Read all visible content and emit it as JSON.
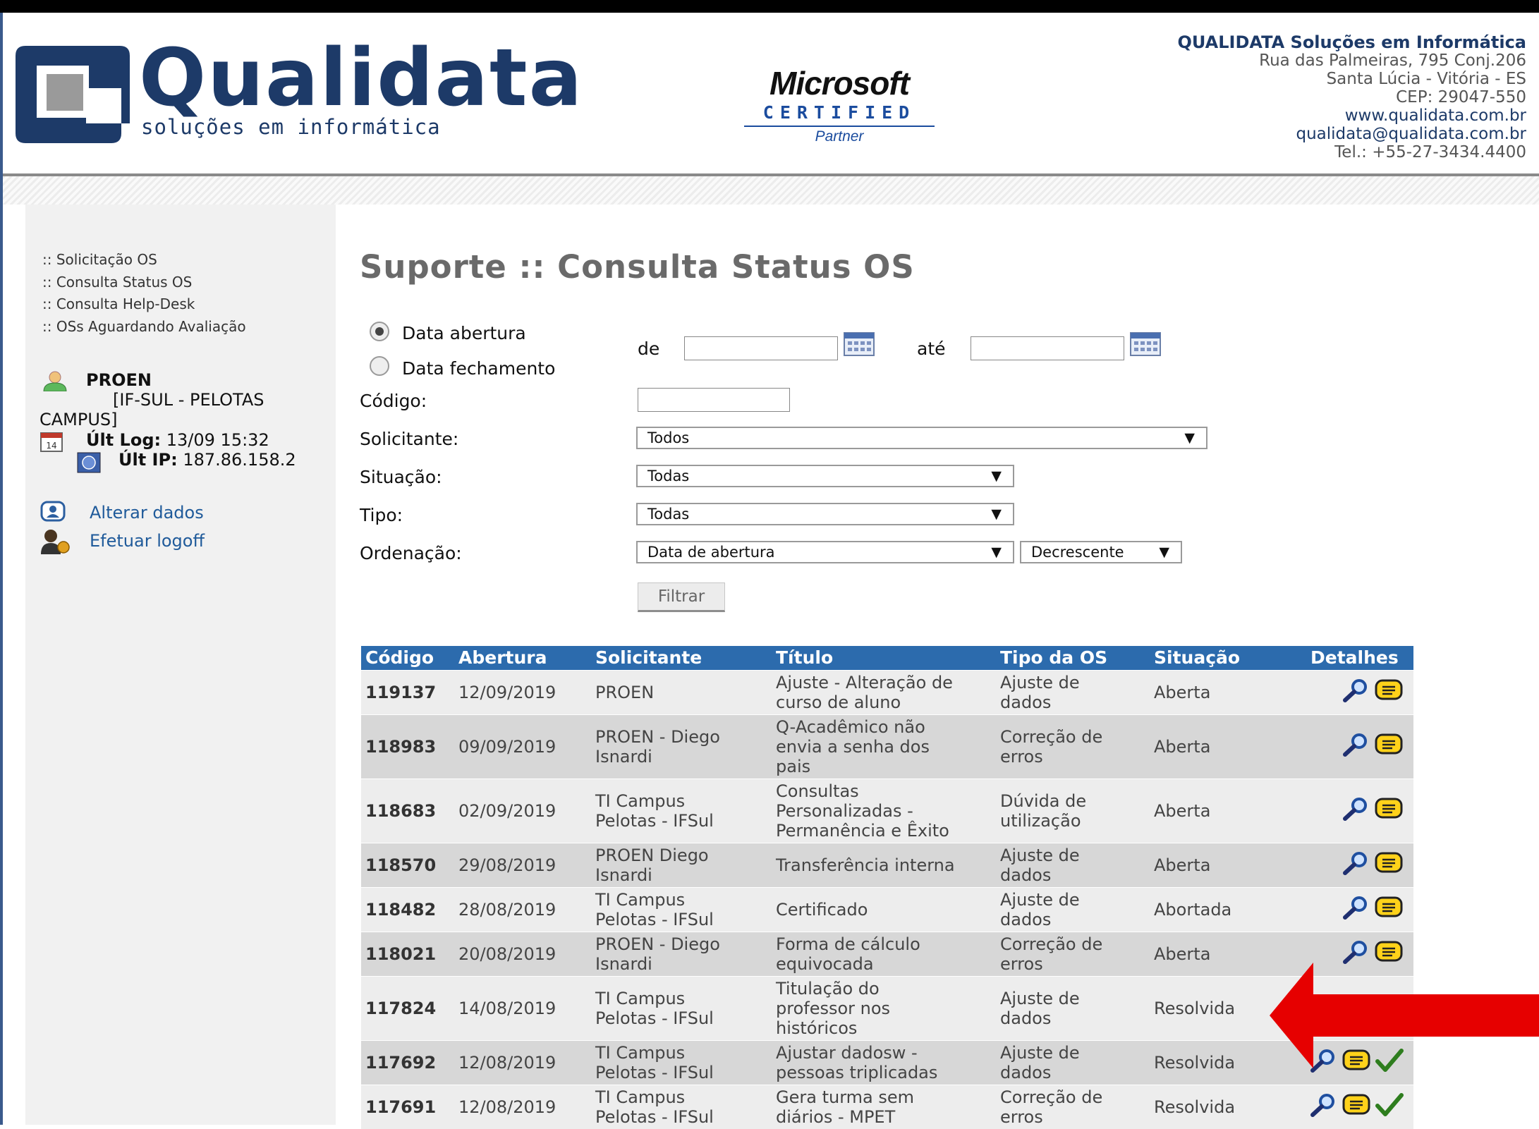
{
  "company": {
    "logo_name": "Qualidata",
    "logo_sub": "soluções em informática",
    "contact_title": "QUALIDATA Soluções em Informática",
    "address1": "Rua das Palmeiras, 795 Conj.206",
    "address2": "Santa Lúcia - Vitória - ES",
    "cep": "CEP: 29047-550",
    "website": "www.qualidata.com.br",
    "email": "qualidata@qualidata.com.br",
    "phone": "Tel.: +55-27-3434.4400"
  },
  "partner": {
    "brand": "Microsoft",
    "certified": "CERTIFIED",
    "partner": "Partner"
  },
  "sidebar": {
    "menu": [
      ":: Solicitação OS",
      ":: Consulta Status OS",
      ":: Consulta Help-Desk",
      ":: OSs Aguardando Avaliação"
    ],
    "user_name": "PROEN",
    "user_org": "[IF-SUL - PELOTAS CAMPUS]",
    "last_log_label": "Últ Log:",
    "last_log_value": "13/09 15:32",
    "last_ip_label": "Últ IP:",
    "last_ip_value": "187.86.158.2",
    "alter_label": "Alterar dados",
    "logoff_label": "Efetuar logoff"
  },
  "page": {
    "title": "Suporte :: Consulta Status OS"
  },
  "filters": {
    "radio_open": "Data abertura",
    "radio_close": "Data fechamento",
    "de": "de",
    "ate": "até",
    "codigo_label": "Código:",
    "solicitante_label": "Solicitante:",
    "solicitante_value": "Todos",
    "situacao_label": "Situação:",
    "situacao_value": "Todas",
    "tipo_label": "Tipo:",
    "tipo_value": "Todas",
    "ordenacao_label": "Ordenação:",
    "ordenacao_value": "Data de abertura",
    "ordem_value": "Decrescente",
    "filter_button": "Filtrar",
    "dropdown_arrow": "▼"
  },
  "table": {
    "headers": [
      "Código",
      "Abertura",
      "Solicitante",
      "Título",
      "Tipo da OS",
      "Situação",
      "Detalhes"
    ],
    "rows": [
      {
        "code": "119137",
        "date": "12/09/2019",
        "sol": [
          "PROEN"
        ],
        "title": [
          "Ajuste - Alteração de",
          "curso de aluno"
        ],
        "type": [
          "Ajuste de",
          "dados"
        ],
        "status": "Aberta",
        "check": false
      },
      {
        "code": "118983",
        "date": "09/09/2019",
        "sol": [
          "PROEN - Diego",
          "Isnardi"
        ],
        "title": [
          "Q-Acadêmico não",
          "envia a senha dos",
          "pais"
        ],
        "type": [
          "Correção de",
          "erros"
        ],
        "status": "Aberta",
        "check": false
      },
      {
        "code": "118683",
        "date": "02/09/2019",
        "sol": [
          "TI Campus",
          "Pelotas - IFSul"
        ],
        "title": [
          "Consultas",
          "Personalizadas -",
          "Permanência e Êxito"
        ],
        "type": [
          "Dúvida de",
          "utilização"
        ],
        "status": "Aberta",
        "check": false
      },
      {
        "code": "118570",
        "date": "29/08/2019",
        "sol": [
          "PROEN Diego",
          "Isnardi"
        ],
        "title": [
          "Transferência interna"
        ],
        "type": [
          "Ajuste de",
          "dados"
        ],
        "status": "Aberta",
        "check": false
      },
      {
        "code": "118482",
        "date": "28/08/2019",
        "sol": [
          "TI Campus",
          "Pelotas - IFSul"
        ],
        "title": [
          "Certificado"
        ],
        "type": [
          "Ajuste de",
          "dados"
        ],
        "status": "Abortada",
        "check": false
      },
      {
        "code": "118021",
        "date": "20/08/2019",
        "sol": [
          "PROEN - Diego",
          "Isnardi"
        ],
        "title": [
          "Forma de cálculo",
          "equivocada"
        ],
        "type": [
          "Correção de",
          "erros"
        ],
        "status": "Aberta",
        "check": false
      },
      {
        "code": "117824",
        "date": "14/08/2019",
        "sol": [
          "TI Campus",
          "Pelotas - IFSul"
        ],
        "title": [
          "Titulação do",
          "professor nos",
          "históricos"
        ],
        "type": [
          "Ajuste de",
          "dados"
        ],
        "status": "Resolvida",
        "check": false,
        "hide_actions": true
      },
      {
        "code": "117692",
        "date": "12/08/2019",
        "sol": [
          "TI Campus",
          "Pelotas - IFSul"
        ],
        "title": [
          "Ajustar dadosw -",
          "pessoas triplicadas"
        ],
        "type": [
          "Ajuste de",
          "dados"
        ],
        "status": "Resolvida",
        "check": true
      },
      {
        "code": "117691",
        "date": "12/08/2019",
        "sol": [
          "TI Campus",
          "Pelotas - IFSul"
        ],
        "title": [
          "Gera turma sem",
          "diários - MPET"
        ],
        "type": [
          "Correção de",
          "erros"
        ],
        "status": "Resolvida",
        "check": true
      }
    ]
  },
  "icons": {
    "details": "magnifier-icon",
    "notes": "notes-icon",
    "evaluate": "checkmark-icon",
    "annotation": "red-arrow-icon"
  },
  "colors": {
    "header_bg": "#2c6bad",
    "row_light": "#ededed",
    "row_dark": "#d7d7d7",
    "link": "#1f5a9a",
    "arrow": "#e60000"
  }
}
